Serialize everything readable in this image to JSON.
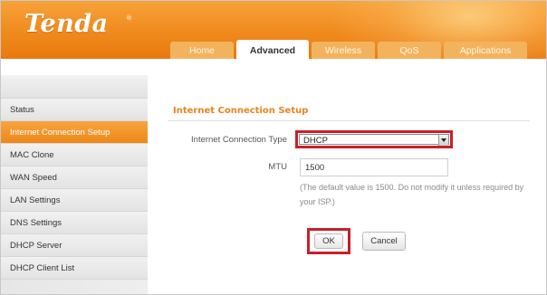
{
  "brand": {
    "logo": "Tenda",
    "registered": "®"
  },
  "tabs": [
    {
      "label": "Home",
      "active": false
    },
    {
      "label": "Advanced",
      "active": true
    },
    {
      "label": "Wireless",
      "active": false
    },
    {
      "label": "QoS",
      "active": false
    },
    {
      "label": "Applications",
      "active": false
    }
  ],
  "sidebar": {
    "items": [
      {
        "label": "Status",
        "active": false
      },
      {
        "label": "Internet Connection Setup",
        "active": true
      },
      {
        "label": "MAC Clone",
        "active": false
      },
      {
        "label": "WAN Speed",
        "active": false
      },
      {
        "label": "LAN Settings",
        "active": false
      },
      {
        "label": "DNS Settings",
        "active": false
      },
      {
        "label": "DHCP Server",
        "active": false
      },
      {
        "label": "DHCP Client List",
        "active": false
      }
    ]
  },
  "main": {
    "title": "Internet Connection Setup",
    "connection_type_label": "Internet Connection Type",
    "connection_type_value": "DHCP",
    "mtu_label": "MTU",
    "mtu_value": "1500",
    "mtu_hint": "(The default value is 1500. Do not modify it unless required by your ISP.)",
    "ok_label": "OK",
    "cancel_label": "Cancel"
  },
  "colors": {
    "brand_orange": "#f08a1d",
    "highlight_red": "#c8202a",
    "title_orange": "#e8851e"
  },
  "icons": {
    "dropdown": "chevron-down-icon"
  }
}
